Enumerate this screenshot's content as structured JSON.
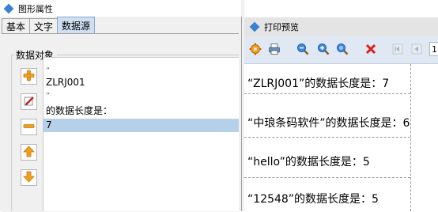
{
  "left_window": {
    "title": "图形属性",
    "tabs": [
      {
        "label": "基本",
        "active": false
      },
      {
        "label": "文字",
        "active": false
      },
      {
        "label": "数据源",
        "active": true
      }
    ],
    "group_label": "数据对象",
    "side_buttons": [
      "add-icon",
      "edit-icon",
      "remove-icon",
      "move-up-icon",
      "move-down-icon"
    ],
    "list_items": [
      "“",
      "ZLRJ001",
      "”",
      "的数据长度是：",
      "7"
    ],
    "selected_index": 4
  },
  "right_window": {
    "title": "打印预览",
    "toolbar_icons": [
      "settings-icon",
      "print-icon",
      "zoom-out-icon",
      "zoom-in-icon",
      "zoom-fit-icon",
      "close-icon",
      "first-page-icon",
      "prev-page-icon"
    ],
    "page_number": "1",
    "results": [
      "“ZLRJ001”的数据长度是：7",
      "“中琅条码软件”的数据长度是：6",
      "“hello”的数据长度是：5",
      "“12548”的数据长度是：5"
    ]
  },
  "colors": {
    "selection": "#b7d0ea",
    "active_tab": "#cfe0f3",
    "toolbar_bg": "#dfe8f3",
    "accent_blue": "#3a7fd0",
    "close_red": "#d81e1e",
    "arrow_orange": "#f0a01e"
  }
}
